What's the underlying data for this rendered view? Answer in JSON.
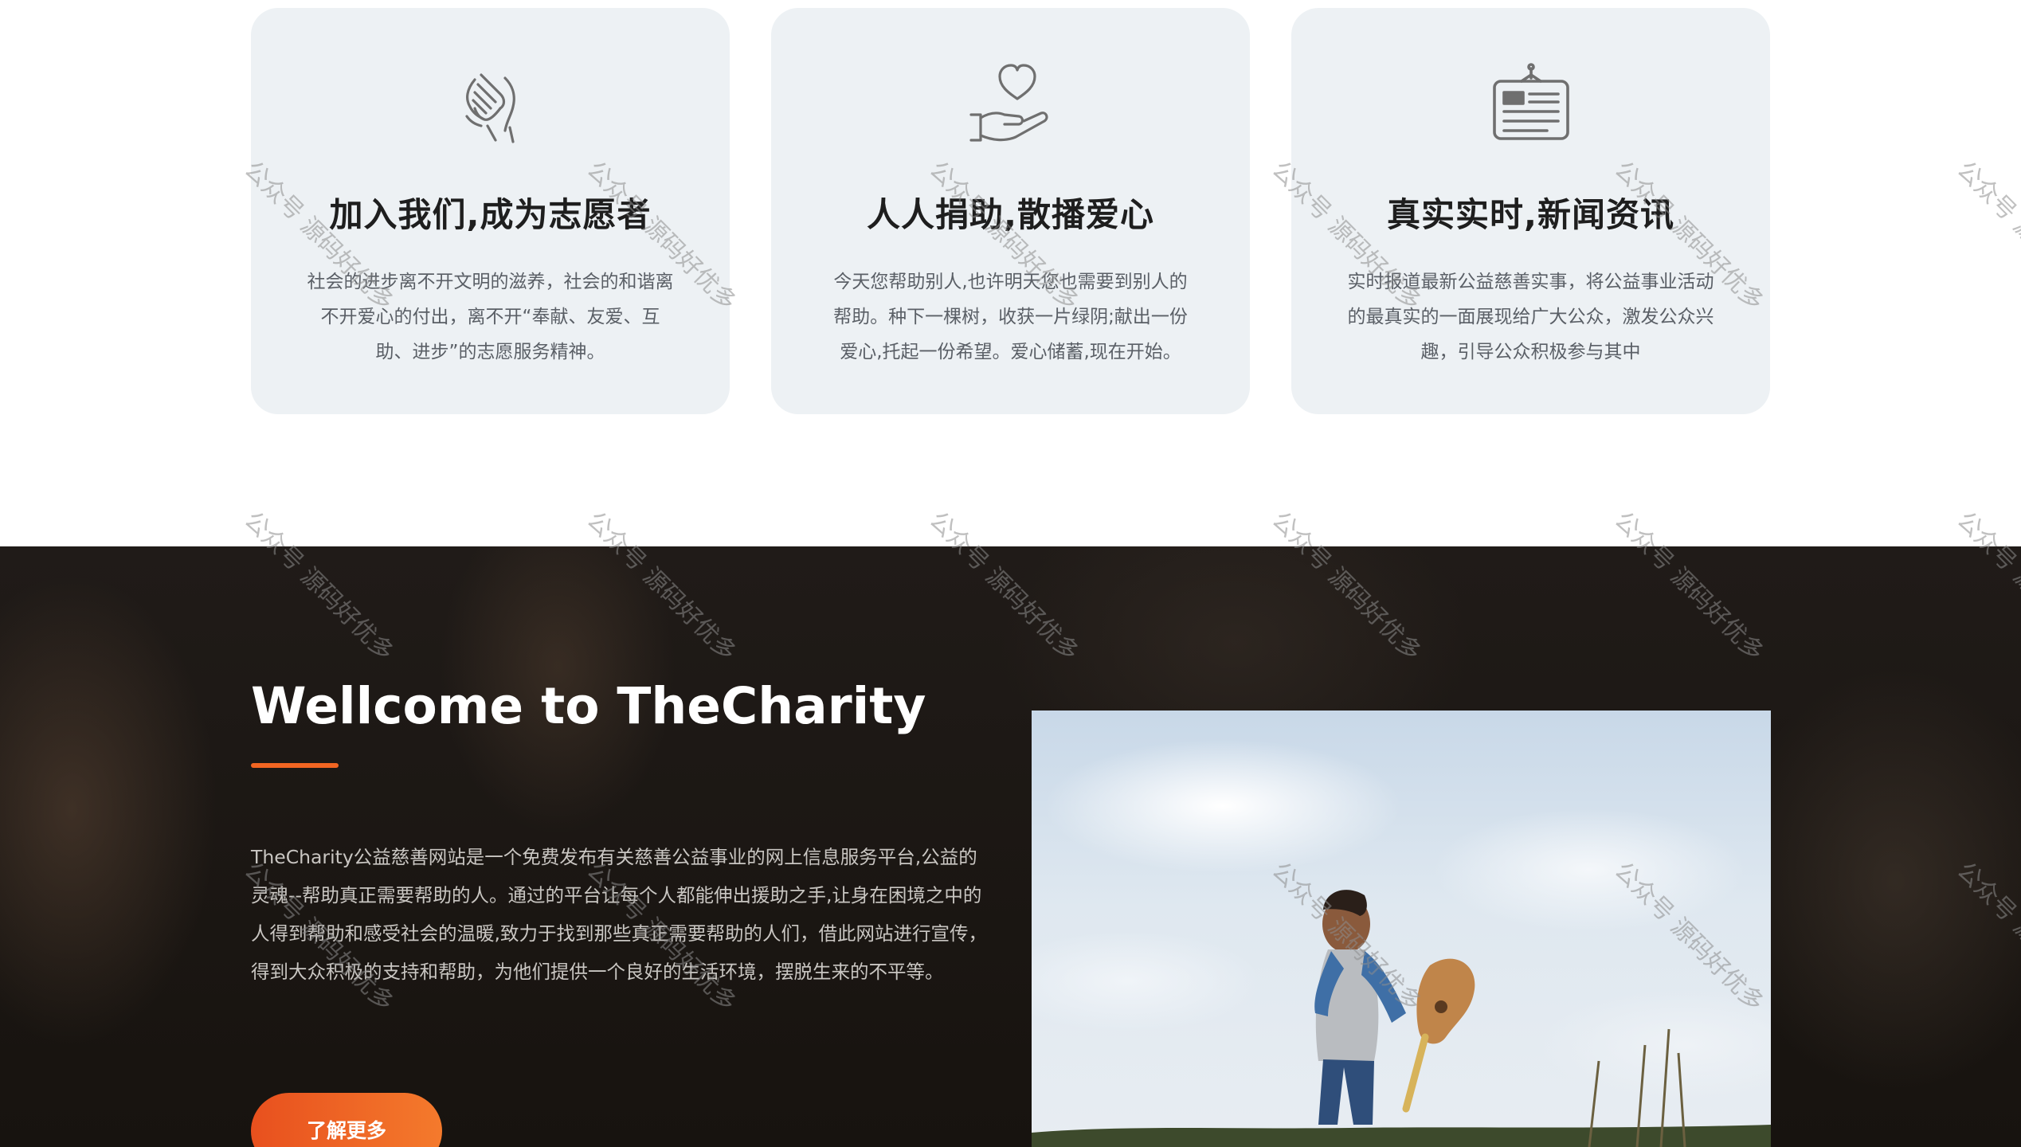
{
  "features": [
    {
      "icon": "hands-clasp-icon",
      "title": "加入我们,成为志愿者",
      "text": "社会的进步离不开文明的滋养，社会的和谐离不开爱心的付出，离不开“奉献、友爱、互助、进步”的志愿服务精神。"
    },
    {
      "icon": "heart-in-hand-icon",
      "title": "人人捐助,散播爱心",
      "text": "今天您帮助别人,也许明天您也需要到别人的帮助。种下一棵树，收获一片绿阴;献出一份爱心,托起一份希望。爱心储蓄,现在开始。"
    },
    {
      "icon": "news-board-icon",
      "title": "真实实时,新闻资讯",
      "text": "实时报道最新公益慈善实事，将公益事业活动的最真实的一面展现给广大公众，激发公众兴趣，引导公众积极参与其中"
    }
  ],
  "welcome": {
    "title": "Wellcome to TheCharity",
    "text": "TheCharity公益慈善网站是一个免费发布有关慈善公益事业的网上信息服务平台,公益的灵魂--帮助真正需要帮助的人。通过的平台让每个人都能伸出援助之手,让身在困境之中的人得到帮助和感受社会的温暖,致力于找到那些真正需要帮助的人们，借此网站进行宣传，得到大众积极的支持和帮助，为他们提供一个良好的生活环境，摆脱生来的不平等。",
    "button_label": "了解更多",
    "accent_color": "#f26522"
  },
  "watermark": "公众号 源码好优多"
}
